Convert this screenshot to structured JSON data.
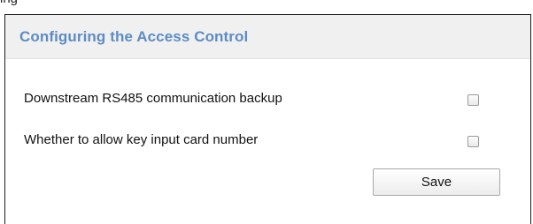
{
  "top_label": "ing",
  "panel": {
    "title": "Configuring the Access Control",
    "options": [
      {
        "label": "Downstream RS485 communication backup",
        "checked": false
      },
      {
        "label": "Whether to allow key input card number",
        "checked": false
      }
    ],
    "save_label": "Save"
  },
  "colors": {
    "title": "#5d8cc4",
    "header_bg": "#f0f0f0"
  }
}
